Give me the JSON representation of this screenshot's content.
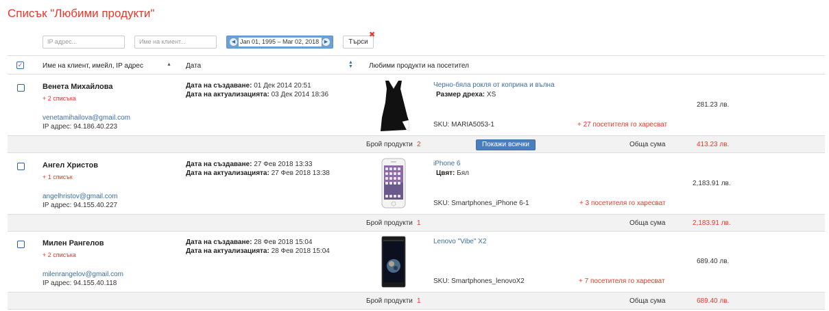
{
  "page": {
    "title": "Списък \"Любими продукти\""
  },
  "filters": {
    "ip_placeholder": "IP адрес...",
    "name_placeholder": "Име на клиент...",
    "date_range": "Jan 01, 1995 – Mar 02, 2018",
    "search_label": "Търси"
  },
  "table": {
    "headers": {
      "client": "Име на клиент, имейл, IP адрес",
      "date": "Дата",
      "products": "Любими продукти на посетител"
    }
  },
  "entries": [
    {
      "name": "Венета Михайлова",
      "lists": "+ 2 списъка",
      "email": "venetamihailova@gmail.com",
      "ip": "IP адрес: 94.186.40.223",
      "created_label": "Дата на създаване:",
      "created": "01 Дек 2014 20:51",
      "updated_label": "Дата на актуализацията:",
      "updated": "03 Дек 2014 18:36",
      "product": {
        "image": "dress-image",
        "name": "Черно-бяла рокля от коприна и вълна",
        "attr_label": "Размер дреха:",
        "attr_value": "XS",
        "sku": "SKU: MARIA5053-1",
        "likes": "+ 27 посетителя го харесват",
        "price": "281.23 лв."
      },
      "summary": {
        "count_label": "Брой продукти",
        "count": "2",
        "show_all": "Покажи всички",
        "total_label": "Обща сума",
        "total": "413.23 лв."
      }
    },
    {
      "name": "Ангел Христов",
      "lists": "+ 1 списък",
      "email": "angelhristov@gmail.com",
      "ip": "IP адрес: 94.155.40.227",
      "created_label": "Дата на създаване:",
      "created": "27 Фев 2018 13:33",
      "updated_label": "Дата на актуализацията:",
      "updated": "27 Фев 2018 13:38",
      "product": {
        "image": "iphone-image",
        "name": "iPhone 6",
        "attr_label": "Цвят:",
        "attr_value": "Бял",
        "sku": "SKU: Smartphones_iPhone 6-1",
        "likes": "+ 3 посетителя го харесват",
        "price": "2,183.91 лв."
      },
      "summary": {
        "count_label": "Брой продукти",
        "count": "1",
        "total_label": "Обща сума",
        "total": "2,183.91 лв."
      }
    },
    {
      "name": "Милен Рангелов",
      "lists": "+ 2 списъка",
      "email": "milenrangelov@gmail.com",
      "ip": "IP адрес: 94.155.40.118",
      "created_label": "Дата на създаване:",
      "created": "28 Фев 2018 15:04",
      "updated_label": "Дата на актуализацията:",
      "updated": "28 Фев 2018 15:04",
      "product": {
        "image": "lenovo-phone-image",
        "name": "Lenovo \"Vibe\" X2",
        "sku": "SKU: Smartphones_lenovoX2",
        "likes": "+ 7 посетителя го харесват",
        "price": "689.40 лв."
      },
      "summary": {
        "count_label": "Брой продукти",
        "count": "1",
        "total_label": "Обща сума",
        "total": "689.40 лв."
      }
    }
  ],
  "colors": {
    "accent_red": "#e8382a",
    "link_blue": "#3a6ea5",
    "button_blue": "#4a7fbf"
  }
}
